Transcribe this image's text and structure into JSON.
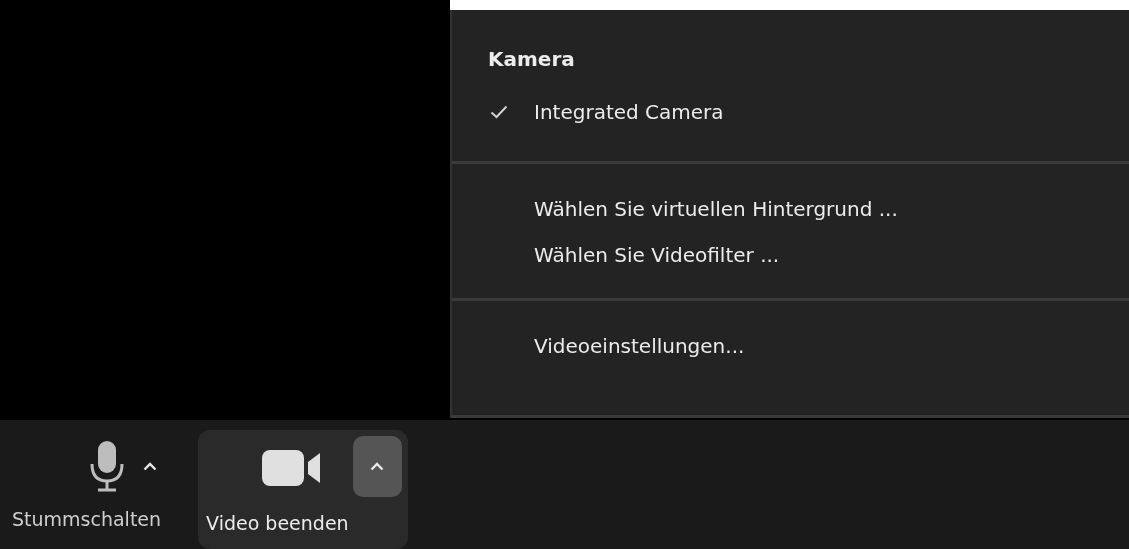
{
  "camera_menu": {
    "title": "Kamera",
    "sections": [
      {
        "items": [
          {
            "label": "Integrated Camera",
            "checked": true
          }
        ]
      },
      {
        "items": [
          {
            "label": "Wählen Sie virtuellen Hintergrund ...",
            "checked": false
          },
          {
            "label": "Wählen Sie Videofilter ...",
            "checked": false
          }
        ]
      },
      {
        "items": [
          {
            "label": "Videoeinstellungen...",
            "checked": false
          }
        ]
      }
    ]
  },
  "toolbar": {
    "buttons": [
      {
        "kind": "microphone",
        "label": "Stummschalten",
        "expanded": false
      },
      {
        "kind": "camera",
        "label": "Video beenden",
        "expanded": true
      }
    ]
  }
}
